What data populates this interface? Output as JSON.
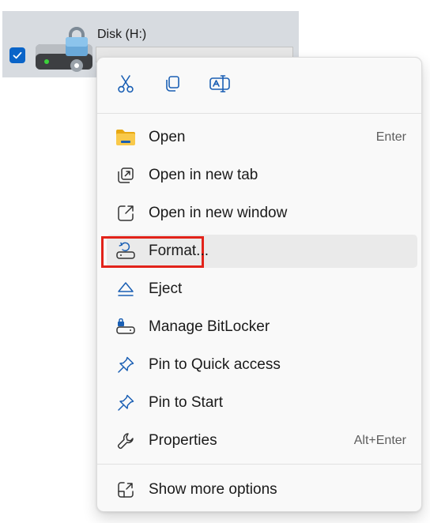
{
  "drive": {
    "name": "Disk (H:)",
    "selected": true,
    "icon": "locked-hard-drive-icon"
  },
  "menu": {
    "quick_actions": [
      {
        "name": "cut",
        "icon": "scissors-icon"
      },
      {
        "name": "copy",
        "icon": "copy-icon"
      },
      {
        "name": "rename",
        "icon": "rename-icon"
      }
    ],
    "items": [
      {
        "label": "Open",
        "shortcut": "Enter",
        "icon": "folder-icon"
      },
      {
        "label": "Open in new tab",
        "shortcut": "",
        "icon": "new-tab-icon"
      },
      {
        "label": "Open in new window",
        "shortcut": "",
        "icon": "new-window-icon"
      },
      {
        "label": "Format...",
        "shortcut": "",
        "icon": "format-drive-icon",
        "hovered": true,
        "highlighted": true
      },
      {
        "label": "Eject",
        "shortcut": "",
        "icon": "eject-icon"
      },
      {
        "label": "Manage BitLocker",
        "shortcut": "",
        "icon": "bitlocker-drive-icon"
      },
      {
        "label": "Pin to Quick access",
        "shortcut": "",
        "icon": "pin-icon"
      },
      {
        "label": "Pin to Start",
        "shortcut": "",
        "icon": "pin-icon"
      },
      {
        "label": "Properties",
        "shortcut": "Alt+Enter",
        "icon": "wrench-icon"
      }
    ],
    "more": {
      "label": "Show more options",
      "icon": "show-more-icon"
    }
  },
  "colors": {
    "accent": "#0a64c8",
    "highlight_border": "#e2231a",
    "hover_bg": "#eaeaea",
    "menu_bg": "#f9f9f9",
    "tile_bg": "#d7dbe0"
  }
}
